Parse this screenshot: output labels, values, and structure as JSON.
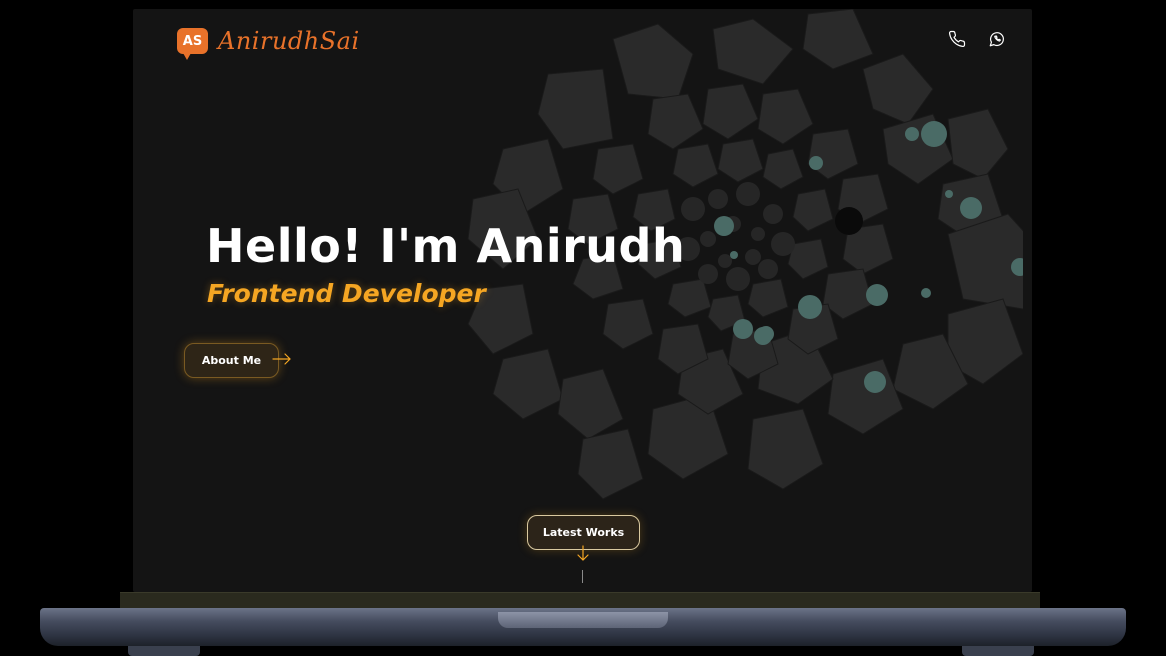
{
  "header": {
    "logo_badge": "AS",
    "logo_text": "AnirudhSai",
    "icons": [
      "phone-icon",
      "whatsapp-icon"
    ]
  },
  "hero": {
    "title": "Hello! I'm Anirudh",
    "subtitle": "Frontend Developer",
    "about_label": "About Me"
  },
  "works": {
    "label": "Latest Works"
  },
  "colors": {
    "accent": "#f5a623",
    "logo": "#e8722a",
    "background": "#141414",
    "teal_dots": "#4a6b66"
  }
}
